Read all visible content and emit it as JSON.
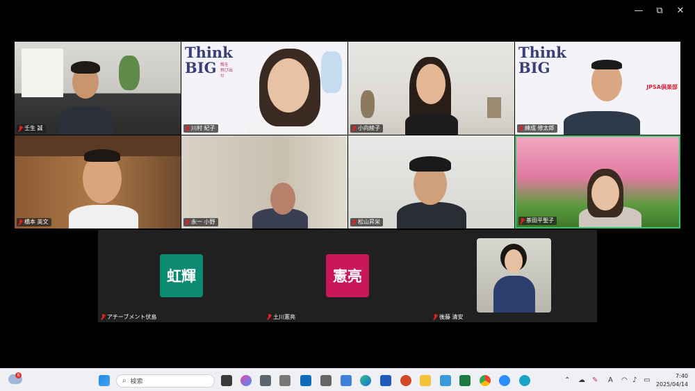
{
  "window_controls": {
    "minimize": "—",
    "restore": "⧉",
    "close": "✕"
  },
  "participants": [
    {
      "name": "壬生 誠"
    },
    {
      "name": "川村 紀子"
    },
    {
      "name": "小向綾子"
    },
    {
      "name": "練成 修太郎"
    },
    {
      "name": "橋本 英文"
    },
    {
      "name": "永一 小野"
    },
    {
      "name": "松山昇栄"
    },
    {
      "name": "茶田平聖子"
    }
  ],
  "backgrounds": {
    "think": "Think",
    "big": "BIG",
    "tagline": "殻を 飛び出せ",
    "banner": "JPSA倶楽部"
  },
  "bottom_participants": [
    {
      "name": "アチーブメント伏島",
      "avatar_text": "虹輝",
      "avatar_color": "#0d8a72"
    },
    {
      "name": "土川憲亮",
      "avatar_text": "憲亮",
      "avatar_color": "#c8185a"
    },
    {
      "name": "後藤 清安"
    }
  ],
  "taskbar": {
    "weather_badge": "6",
    "search_placeholder": "検索",
    "time": "7:40",
    "date": "2025/04/14",
    "ime_label": "A"
  },
  "colors": {
    "active_speaker": "#2ecc71",
    "muted_mic": "#e02020"
  }
}
